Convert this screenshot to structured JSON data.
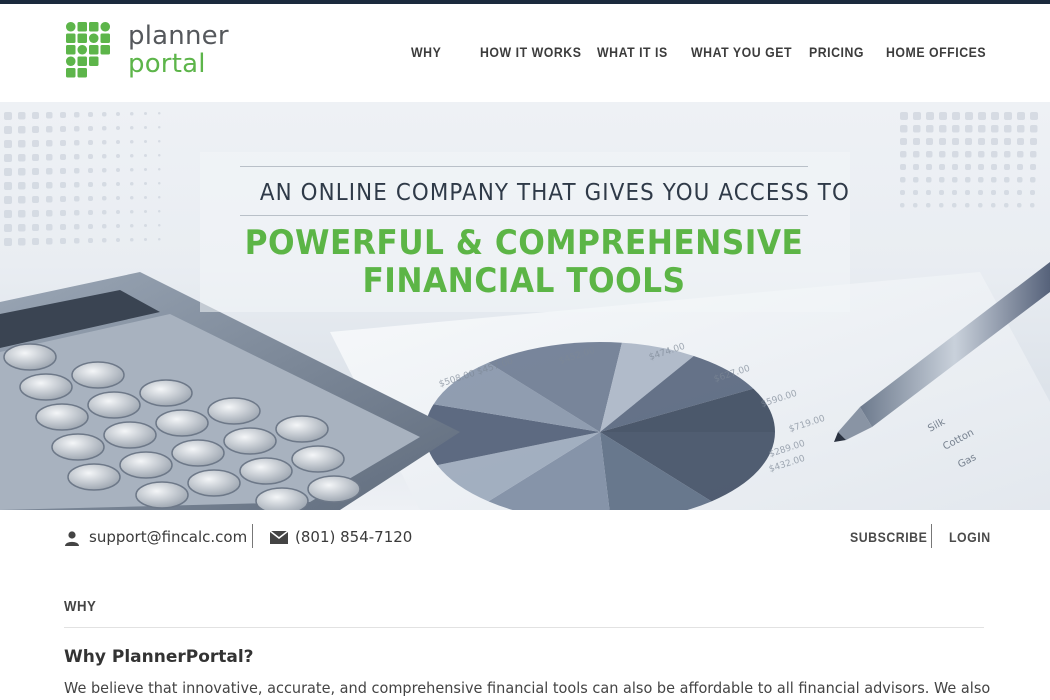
{
  "brand": {
    "word1": "planner",
    "word2": "portal",
    "green": "#5db54a",
    "gray": "#55585c"
  },
  "nav": {
    "items": [
      {
        "label": "WHY",
        "name": "nav-why"
      },
      {
        "label": "HOW IT WORKS",
        "name": "nav-how-it-works"
      },
      {
        "label": "WHAT IT IS",
        "name": "nav-what-it-is"
      },
      {
        "label": "WHAT YOU GET",
        "name": "nav-what-you-get"
      },
      {
        "label": "PRICING",
        "name": "nav-pricing"
      },
      {
        "label": "HOME OFFICES",
        "name": "nav-home-offices"
      }
    ]
  },
  "hero": {
    "subtitle": "AN ONLINE COMPANY THAT GIVES YOU ACCESS TO",
    "title_line1": "POWERFUL & COMPREHENSIVE",
    "title_line2": "FINANCIAL TOOLS",
    "background": "calculator-chart-pen-photo"
  },
  "contact": {
    "email": "support@fincalc.com",
    "phone": "(801) 854-7120",
    "email_icon": "user-icon",
    "phone_icon": "envelope-icon",
    "subscribe": "SUBSCRIBE",
    "login": "LOGIN"
  },
  "content": {
    "section_label": "WHY",
    "heading": "Why PlannerPortal?",
    "paragraph": "We believe that innovative, accurate, and comprehensive financial tools can also be affordable to all financial advisors. We also"
  }
}
